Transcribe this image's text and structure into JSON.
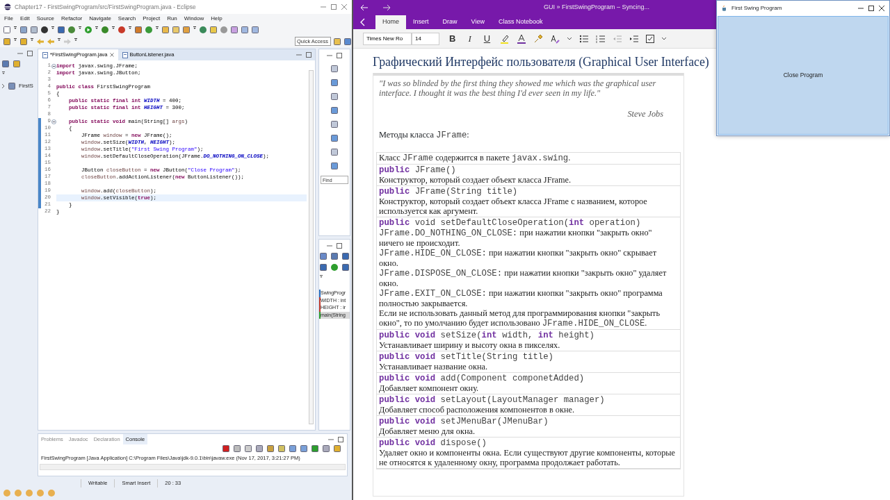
{
  "eclipse": {
    "title": "Chapter17 - FirstSwingProgram/src/FirstSwingProgram.java - Eclipse",
    "menu": [
      "File",
      "Edit",
      "Source",
      "Refactor",
      "Navigate",
      "Search",
      "Project",
      "Run",
      "Window",
      "Help"
    ],
    "quick_access": {
      "placeholder": "Quick Access"
    },
    "package_explorer": [
      {
        "label": "FirstS"
      }
    ],
    "editor_tabs": [
      {
        "label": "*FirstSwingProgram.java",
        "selected": true
      },
      {
        "label": "ButtonListener.java",
        "selected": false
      }
    ],
    "code_lines": [
      {
        "num": "1",
        "fold": true,
        "changed": false,
        "current": false,
        "code": [
          {
            "text": "import",
            "kind": "kw"
          },
          {
            "text": " javax.swing.JFrame;",
            "kind": "plain"
          }
        ]
      },
      {
        "num": "2",
        "fold": false,
        "changed": false,
        "current": false,
        "code": [
          {
            "text": "import",
            "kind": "kw"
          },
          {
            "text": " javax.swing.JButton;",
            "kind": "plain"
          }
        ]
      },
      {
        "num": "3",
        "fold": false,
        "changed": false,
        "current": false
      },
      {
        "num": "4",
        "fold": false,
        "changed": false,
        "current": false,
        "code": [
          {
            "text": "public class",
            "kind": "kw"
          },
          {
            "text": " FirstSwingProgram",
            "kind": "plain"
          }
        ]
      },
      {
        "num": "5",
        "fold": false,
        "changed": false,
        "current": false,
        "code": [
          {
            "text": "{",
            "kind": "plain"
          }
        ]
      },
      {
        "num": "6",
        "fold": false,
        "changed": false,
        "current": false,
        "code": [
          {
            "text": "    public static final int ",
            "kind": "kw"
          },
          {
            "text": "WIDTH",
            "kind": "const"
          },
          {
            "text": " = 400;",
            "kind": "plain"
          }
        ]
      },
      {
        "num": "7",
        "fold": false,
        "changed": false,
        "current": false,
        "code": [
          {
            "text": "    public static final int ",
            "kind": "kw"
          },
          {
            "text": "HEIGHT",
            "kind": "const"
          },
          {
            "text": " = 300;",
            "kind": "plain"
          }
        ]
      },
      {
        "num": "8",
        "fold": false,
        "changed": false,
        "current": false
      },
      {
        "num": "9",
        "fold": true,
        "changed": true,
        "current": false,
        "code": [
          {
            "text": "    public static void",
            "kind": "kw"
          },
          {
            "text": " main(String[] ",
            "kind": "plain"
          },
          {
            "text": "args",
            "kind": "var"
          },
          {
            "text": ")",
            "kind": "plain"
          }
        ]
      },
      {
        "num": "10",
        "fold": false,
        "changed": true,
        "current": false,
        "code": [
          {
            "text": "    {",
            "kind": "plain"
          }
        ]
      },
      {
        "num": "11",
        "fold": false,
        "changed": true,
        "current": false,
        "code": [
          {
            "text": "        JFrame ",
            "kind": "plain"
          },
          {
            "text": "window",
            "kind": "var"
          },
          {
            "text": " = ",
            "kind": "plain"
          },
          {
            "text": "new",
            "kind": "kw"
          },
          {
            "text": " JFrame();",
            "kind": "plain"
          }
        ]
      },
      {
        "num": "12",
        "fold": false,
        "changed": true,
        "current": false,
        "code": [
          {
            "text": "        window",
            "kind": "var"
          },
          {
            "text": ".setSize(",
            "kind": "plain"
          },
          {
            "text": "WIDTH",
            "kind": "const"
          },
          {
            "text": ", ",
            "kind": "plain"
          },
          {
            "text": "HEIGHT",
            "kind": "const"
          },
          {
            "text": ");",
            "kind": "plain"
          }
        ]
      },
      {
        "num": "13",
        "fold": false,
        "changed": true,
        "current": false,
        "code": [
          {
            "text": "        window",
            "kind": "var"
          },
          {
            "text": ".setTitle(",
            "kind": "plain"
          },
          {
            "text": "\"First Swing Program\"",
            "kind": "str"
          },
          {
            "text": ");",
            "kind": "plain"
          }
        ]
      },
      {
        "num": "14",
        "fold": false,
        "changed": true,
        "current": false,
        "code": [
          {
            "text": "        window",
            "kind": "var"
          },
          {
            "text": ".setDefaultCloseOperation(JFrame.",
            "kind": "plain"
          },
          {
            "text": "DO_NOTHING_ON_CLOSE",
            "kind": "const"
          },
          {
            "text": ");",
            "kind": "plain"
          }
        ]
      },
      {
        "num": "15",
        "fold": false,
        "changed": true,
        "current": false
      },
      {
        "num": "16",
        "fold": false,
        "changed": true,
        "current": false,
        "code": [
          {
            "text": "        JButton ",
            "kind": "plain"
          },
          {
            "text": "closeButton",
            "kind": "var"
          },
          {
            "text": " = ",
            "kind": "plain"
          },
          {
            "text": "new",
            "kind": "kw"
          },
          {
            "text": " JButton(",
            "kind": "plain"
          },
          {
            "text": "\"Close Program\"",
            "kind": "str"
          },
          {
            "text": ");",
            "kind": "plain"
          }
        ]
      },
      {
        "num": "17",
        "fold": false,
        "changed": true,
        "current": false,
        "code": [
          {
            "text": "        closeButton",
            "kind": "var"
          },
          {
            "text": ".addActionListener(",
            "kind": "plain"
          },
          {
            "text": "new",
            "kind": "kw"
          },
          {
            "text": " ButtonListener());",
            "kind": "plain"
          }
        ]
      },
      {
        "num": "18",
        "fold": false,
        "changed": true,
        "current": false
      },
      {
        "num": "19",
        "fold": false,
        "changed": true,
        "current": false,
        "code": [
          {
            "text": "        window",
            "kind": "var"
          },
          {
            "text": ".add(",
            "kind": "plain"
          },
          {
            "text": "closeButton",
            "kind": "var"
          },
          {
            "text": ");",
            "kind": "plain"
          }
        ]
      },
      {
        "num": "20",
        "fold": false,
        "changed": true,
        "current": true,
        "code": [
          {
            "text": "        window",
            "kind": "var"
          },
          {
            "text": ".setVisible(",
            "kind": "plain"
          },
          {
            "text": "true",
            "kind": "kw"
          },
          {
            "text": ");",
            "kind": "plain"
          }
        ]
      },
      {
        "num": "21",
        "fold": false,
        "changed": true,
        "current": false,
        "code": [
          {
            "text": "    }",
            "kind": "plain"
          }
        ]
      },
      {
        "num": "22",
        "fold": false,
        "changed": false,
        "current": false,
        "code": [
          {
            "text": "}",
            "kind": "plain"
          }
        ]
      }
    ],
    "outline": {
      "find": {
        "placeholder": "Find"
      },
      "items": [
        {
          "label": "SwingProgr",
          "kind": "class",
          "selected": false
        },
        {
          "label": "WIDTH : int",
          "kind": "field",
          "selected": false
        },
        {
          "label": "HEIGHT : ir",
          "kind": "field",
          "selected": false
        },
        {
          "label": "main(String",
          "kind": "method",
          "selected": true
        }
      ]
    },
    "console_tabs": [
      {
        "label": "Problems",
        "selected": false
      },
      {
        "label": "Javadoc",
        "selected": false
      },
      {
        "label": "Declaration",
        "selected": false
      },
      {
        "label": "Console",
        "selected": true
      }
    ],
    "console_text": "FirstSwingProgram [Java Application] C:\\Program Files\\Java\\jdk-9.0.1\\bin\\javaw.exe (Nov 17, 2017, 3:21:27 PM)",
    "status_bar": [
      "Writable",
      "Smart Insert",
      "20 : 33"
    ]
  },
  "onenote": {
    "title": "GUI » FirstSwingProgram – Syncing...",
    "tabs": [
      {
        "label": "Home",
        "selected": true
      },
      {
        "label": "Insert",
        "selected": false
      },
      {
        "label": "Draw",
        "selected": false
      },
      {
        "label": "View",
        "selected": false
      },
      {
        "label": "Class Notebook",
        "selected": false
      }
    ],
    "font": {
      "value": "Times New Ro"
    },
    "font_size": {
      "value": "14"
    },
    "format_buttons": [
      {
        "label": "B",
        "kind": "bold"
      },
      {
        "label": "I",
        "kind": "italic"
      },
      {
        "label": "U",
        "kind": "underline"
      }
    ],
    "page_title": "Графический Интерфейс пользователя (Graphical User Interface)",
    "quote": "\"I was so blinded by the first thing they showed me which was the graphical user interface. I thought it was the best thing I'd ever seen in my life.\"",
    "quote_author": "Steve Jobs",
    "methods_heading": [
      {
        "text": "Методы класса ",
        "kind": "text"
      },
      {
        "text": "JFrame",
        "kind": "mono"
      },
      {
        "text": ":",
        "kind": "text"
      }
    ],
    "table_rows": [
      {
        "lines": [
          [
            {
              "text": "Класс ",
              "kind": "text"
            },
            {
              "text": "JFrame",
              "kind": "mono"
            },
            {
              "text": "  содержится в пакете ",
              "kind": "text"
            },
            {
              "text": "javax.swing",
              "kind": "mono"
            },
            {
              "text": ".",
              "kind": "text"
            }
          ]
        ]
      },
      {
        "lines": [
          [
            {
              "text": "public",
              "kind": "kw"
            },
            {
              "text": " JFrame()",
              "kind": "mono"
            }
          ],
          [
            {
              "text": "Конструктор, который создает объект класса JFrame.",
              "kind": "text"
            }
          ]
        ]
      },
      {
        "lines": [
          [
            {
              "text": "public",
              "kind": "kw"
            },
            {
              "text": " JFrame(String title)",
              "kind": "mono"
            }
          ],
          [
            {
              "text": "Конструктор, который создает объект класса JFrame с названием, которое используется как аргумент.",
              "kind": "text"
            }
          ]
        ]
      },
      {
        "lines": [
          [
            {
              "text": "public",
              "kind": "kw"
            },
            {
              "text": " void setDefaultCloseOperation(",
              "kind": "mono"
            },
            {
              "text": "int",
              "kind": "kw"
            },
            {
              "text": " operation)",
              "kind": "mono"
            }
          ],
          [
            {
              "text": "JFrame.DO_NOTHING_ON_CLOSE:",
              "kind": "mono"
            },
            {
              "text": "  при нажатии кнопки \"закрыть окно\" ничего не происходит.",
              "kind": "text"
            }
          ],
          [
            {
              "text": "JFrame.HIDE_ON_CLOSE:",
              "kind": "mono"
            },
            {
              "text": "  при нажатии кнопки \"закрыть окно\" скрывает окно.",
              "kind": "text"
            }
          ],
          [
            {
              "text": "JFrame.DISPOSE_ON_CLOSE:",
              "kind": "mono"
            },
            {
              "text": "  при нажатии кнопки \"закрыть окно\" удаляет окно.",
              "kind": "text"
            }
          ],
          [
            {
              "text": "JFrame.EXIT_ON_CLOSE:",
              "kind": "mono"
            },
            {
              "text": "  при нажатии кнопки \"закрыть окно\" программа полностью закрывается.",
              "kind": "text"
            }
          ],
          [
            {
              "text": "Если не использовать данный метод для программирования кнопки \"закрыть окно\", то по умолчанию будет использовано ",
              "kind": "text"
            },
            {
              "text": "JFrame.HIDE_ON_CLOSE",
              "kind": "mono"
            },
            {
              "text": ".",
              "kind": "text"
            }
          ]
        ]
      },
      {
        "lines": [
          [
            {
              "text": "public void",
              "kind": "kw"
            },
            {
              "text": " setSize(",
              "kind": "mono"
            },
            {
              "text": "int",
              "kind": "kw"
            },
            {
              "text": " width, ",
              "kind": "mono"
            },
            {
              "text": "int",
              "kind": "kw"
            },
            {
              "text": " height)",
              "kind": "mono"
            }
          ],
          [
            {
              "text": "Устанавливает ширину и высоту окна в пикселях.",
              "kind": "text"
            }
          ]
        ]
      },
      {
        "lines": [
          [
            {
              "text": "public void",
              "kind": "kw"
            },
            {
              "text": " setTitle(String title)",
              "kind": "mono"
            }
          ],
          [
            {
              "text": "Устанавливает название окна.",
              "kind": "text"
            }
          ]
        ]
      },
      {
        "lines": [
          [
            {
              "text": "public void",
              "kind": "kw"
            },
            {
              "text": " add(Component componetAdded)",
              "kind": "mono"
            }
          ],
          [
            {
              "text": "Добавляет компонент окну.",
              "kind": "text"
            }
          ]
        ]
      },
      {
        "lines": [
          [
            {
              "text": "public void",
              "kind": "kw"
            },
            {
              "text": " setLayout(LayoutManager manager)",
              "kind": "mono"
            }
          ],
          [
            {
              "text": "Добавляет способ расположения компонентов в окне.",
              "kind": "text"
            }
          ]
        ]
      },
      {
        "lines": [
          [
            {
              "text": "public void",
              "kind": "kw"
            },
            {
              "text": " setJMenuBar(JMenuBar)",
              "kind": "mono"
            }
          ],
          [
            {
              "text": "Добавляет меню для окна.",
              "kind": "text"
            }
          ]
        ]
      },
      {
        "lines": [
          [
            {
              "text": "public void",
              "kind": "kw"
            },
            {
              "text": " dispose()",
              "kind": "mono"
            }
          ],
          [
            {
              "text": "Удаляет окно и компоненты окна. Если существуют другие компоненты, которые не относятся к удаленному окну, программа продолжает работать.",
              "kind": "text"
            }
          ]
        ]
      }
    ]
  },
  "swing_window": {
    "title": "First Swing Program",
    "button": "Close Program"
  }
}
